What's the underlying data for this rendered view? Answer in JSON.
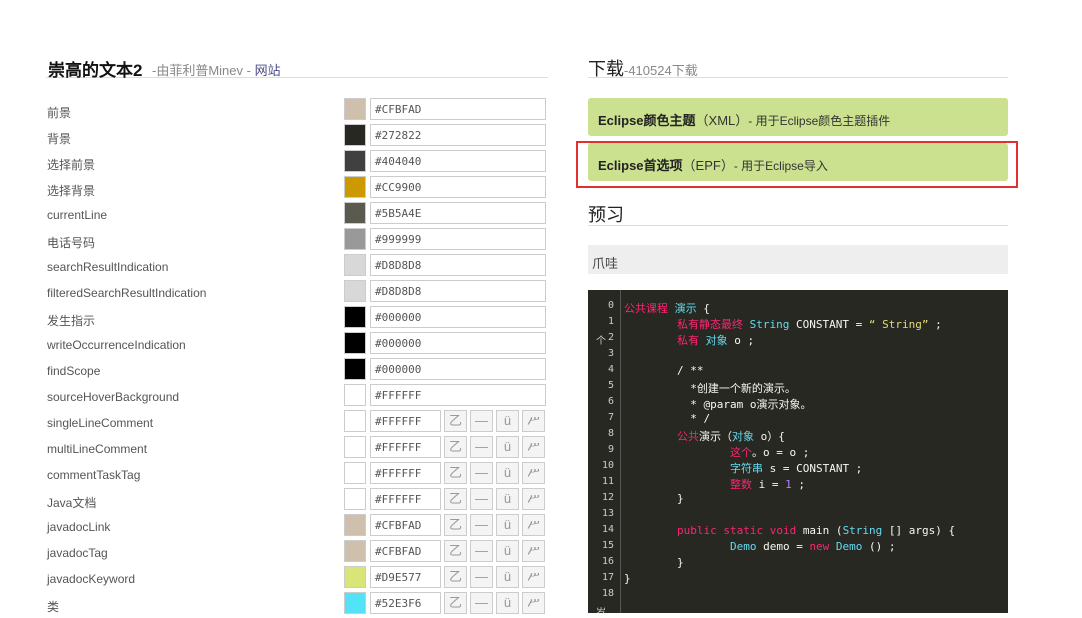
{
  "header": {
    "title": "崇高的文本2",
    "by": "-由菲利普Minev - ",
    "website": "网站"
  },
  "colors": [
    {
      "label": "前景",
      "hex": "#CFBFAD",
      "color": "#CFBFAD",
      "short": false
    },
    {
      "label": "背景",
      "hex": "#272822",
      "color": "#272822",
      "short": false
    },
    {
      "label": "选择前景",
      "hex": "#404040",
      "color": "#404040",
      "short": false
    },
    {
      "label": "选择背景",
      "hex": "#CC9900",
      "color": "#CC9900",
      "short": false
    },
    {
      "label": "currentLine",
      "hex": "#5B5A4E",
      "color": "#5B5A4E",
      "short": false
    },
    {
      "label": "电话号码",
      "hex": "#999999",
      "color": "#999999",
      "short": false
    },
    {
      "label": "searchResultIndication",
      "hex": "#D8D8D8",
      "color": "#D8D8D8",
      "short": false
    },
    {
      "label": "filteredSearchResultIndication",
      "hex": "#D8D8D8",
      "color": "#D8D8D8",
      "short": false
    },
    {
      "label": "发生指示",
      "hex": "#000000",
      "color": "#000000",
      "short": false
    },
    {
      "label": "writeOccurrenceIndication",
      "hex": "#000000",
      "color": "#000000",
      "short": false
    },
    {
      "label": "findScope",
      "hex": "#000000",
      "color": "#000000",
      "short": false
    },
    {
      "label": "sourceHoverBackground",
      "hex": "#FFFFFF",
      "color": "#FFFFFF",
      "short": false
    },
    {
      "label": "singleLineComment",
      "hex": "#FFFFFF",
      "color": "#FFFFFF",
      "short": true
    },
    {
      "label": "multiLineComment",
      "hex": "#FFFFFF",
      "color": "#FFFFFF",
      "short": true
    },
    {
      "label": "commentTaskTag",
      "hex": "#FFFFFF",
      "color": "#FFFFFF",
      "short": true
    },
    {
      "label": "Java文档",
      "hex": "#FFFFFF",
      "color": "#FFFFFF",
      "short": true
    },
    {
      "label": "javadocLink",
      "hex": "#CFBFAD",
      "color": "#CFBFAD",
      "short": true
    },
    {
      "label": "javadocTag",
      "hex": "#CFBFAD",
      "color": "#CFBFAD",
      "short": true
    },
    {
      "label": "javadocKeyword",
      "hex": "#D9E577",
      "color": "#D9E577",
      "short": true
    },
    {
      "label": "类",
      "hex": "#52E3F6",
      "color": "#52E3F6",
      "short": true
    }
  ],
  "style_buttons": [
    "乙",
    "—",
    "ü",
    "ሥ"
  ],
  "download": {
    "title": "下载",
    "count": "-410524下载",
    "options": [
      {
        "bold": "Eclipse颜色主题",
        "mid": "（XML）",
        "desc": "- 用于Eclipse颜色主题插件"
      },
      {
        "bold": "Eclipse首选项",
        "mid": "（EPF）",
        "desc": "- 用于Eclipse导入"
      }
    ]
  },
  "preview": {
    "title": "预习",
    "language": "爪哇"
  },
  "code": {
    "line_numbers": [
      "0",
      "1",
      "2",
      "3",
      "4",
      "5",
      "6",
      "7",
      "8",
      "9",
      "10",
      "11",
      "12",
      "13",
      "14",
      "15",
      "16",
      "17",
      "18"
    ],
    "gutter_glyph_2": "个",
    "gutter_glyph_18": "岁",
    "lines": [
      [
        {
          "t": "公共课程 ",
          "c": "kw"
        },
        {
          "t": "演示",
          "c": "ty"
        },
        {
          "t": " {",
          "c": "cm"
        }
      ],
      [
        {
          "t": "        私有静态最终 ",
          "c": "kw"
        },
        {
          "t": "String",
          "c": "ty"
        },
        {
          "t": " CONSTANT = ",
          "c": "cm"
        },
        {
          "t": "“ String”",
          "c": "st"
        },
        {
          "t": " ;",
          "c": "cm"
        }
      ],
      [
        {
          "t": "        私有 ",
          "c": "kw"
        },
        {
          "t": "对象",
          "c": "ty"
        },
        {
          "t": " o ;",
          "c": "cm"
        }
      ],
      [
        {
          "t": "",
          "c": "cm"
        }
      ],
      [
        {
          "t": "        / **",
          "c": "cm"
        }
      ],
      [
        {
          "t": "          *创建一个新的演示。",
          "c": "cm"
        }
      ],
      [
        {
          "t": "          * @param o演示对象。",
          "c": "cm"
        }
      ],
      [
        {
          "t": "          * /",
          "c": "cm"
        }
      ],
      [
        {
          "t": "        公共",
          "c": "kw"
        },
        {
          "t": "演示（",
          "c": "cm"
        },
        {
          "t": "对象",
          "c": "ty"
        },
        {
          "t": " o）{",
          "c": "cm"
        }
      ],
      [
        {
          "t": "                这个",
          "c": "kw"
        },
        {
          "t": "。o = o ;",
          "c": "cm"
        }
      ],
      [
        {
          "t": "                字符串",
          "c": "ty"
        },
        {
          "t": " s = CONSTANT ;",
          "c": "cm"
        }
      ],
      [
        {
          "t": "                整数",
          "c": "kw"
        },
        {
          "t": " i = ",
          "c": "cm"
        },
        {
          "t": "1",
          "c": "nu"
        },
        {
          "t": " ;",
          "c": "cm"
        }
      ],
      [
        {
          "t": "        }",
          "c": "cm"
        }
      ],
      [
        {
          "t": "",
          "c": "cm"
        }
      ],
      [
        {
          "t": "        public static void ",
          "c": "kw"
        },
        {
          "t": "main",
          "c": "cm"
        },
        {
          "t": " (",
          "c": "cm"
        },
        {
          "t": "String",
          "c": "ty"
        },
        {
          "t": " [] args) {",
          "c": "cm"
        }
      ],
      [
        {
          "t": "                Demo",
          "c": "ty"
        },
        {
          "t": " demo = ",
          "c": "cm"
        },
        {
          "t": "new",
          "c": "kw"
        },
        {
          "t": " Demo",
          "c": "ty"
        },
        {
          "t": " () ;",
          "c": "cm"
        }
      ],
      [
        {
          "t": "        }",
          "c": "cm"
        }
      ],
      [
        {
          "t": "}",
          "c": "cm"
        }
      ],
      [
        {
          "t": "",
          "c": "cm"
        }
      ]
    ]
  }
}
